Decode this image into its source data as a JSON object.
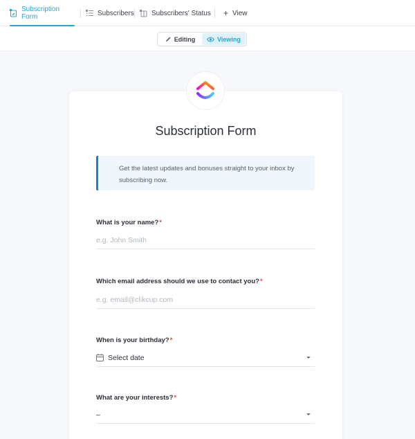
{
  "tabs": [
    {
      "label": "Subscription Form",
      "icon": "form-icon",
      "active": true
    },
    {
      "label": "Subscribers",
      "icon": "list-icon",
      "active": false
    },
    {
      "label": "Subscribers' Status",
      "icon": "board-icon",
      "active": false
    }
  ],
  "add_view": {
    "label": "View",
    "icon": "plus-icon"
  },
  "mode": {
    "editing": "Editing",
    "viewing": "Viewing",
    "selected": "Viewing"
  },
  "form": {
    "title": "Subscription Form",
    "notice": "Get the latest updates and bonuses straight to your inbox by subscribing now.",
    "required_mark": "*",
    "fields": [
      {
        "label": "What is your name?",
        "placeholder": "e.g. John Smith",
        "required": true
      },
      {
        "label": "Which email address should we use to contact you?",
        "placeholder": "e.g. email@clikcup.com",
        "required": true
      },
      {
        "label": "When is your birthday?",
        "value": "Select date",
        "required": true,
        "icon": "calendar-icon"
      },
      {
        "label": "What are your interests?",
        "value": "–",
        "required": true
      }
    ]
  },
  "colors": {
    "accent": "#1ea8d8",
    "notice_bar": "#1a7ed8",
    "required": "#e5484d"
  }
}
